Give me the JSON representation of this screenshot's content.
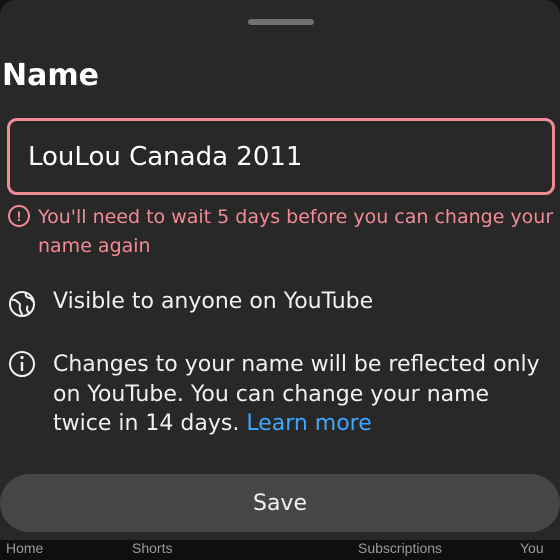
{
  "sheet": {
    "title": "Name",
    "name_input": {
      "value": "LouLou Canada 2011",
      "placeholder": ""
    },
    "error_message": "You'll need to wait 5 days before you can change your name again",
    "visibility_text": "Visible to anyone on YouTube",
    "info_text": "Changes to your name will be reflected only on YouTube. You can change your name twice in 14 days.",
    "learn_more_label": "Learn more",
    "save_label": "Save"
  },
  "bottom_nav": {
    "items": [
      "Home",
      "Shorts",
      "Subscriptions",
      "You"
    ]
  },
  "colors": {
    "sheet_background": "#282828",
    "error": "#f28b96",
    "link": "#3ea6ff",
    "save_button": "#464646"
  },
  "icons": [
    "drag-handle-icon",
    "error-icon",
    "globe-icon",
    "info-icon"
  ]
}
